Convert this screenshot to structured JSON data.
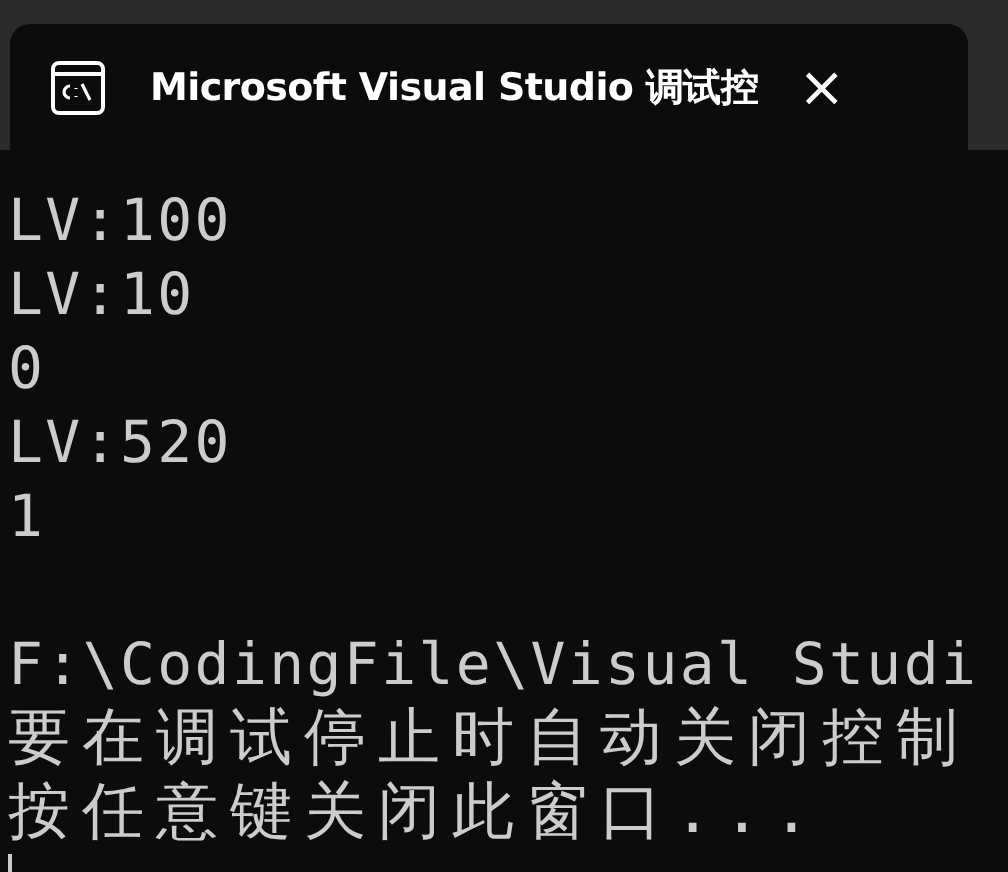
{
  "tab": {
    "title": "Microsoft Visual Studio 调试控",
    "close": "×"
  },
  "console": {
    "lines": [
      {
        "text": "LV:100"
      },
      {
        "text": "LV:10"
      },
      {
        "text": "0"
      },
      {
        "text": "LV:520"
      },
      {
        "text": "1"
      },
      {
        "kind": "blank"
      },
      {
        "text": "F:\\CodingFile\\Visual Studi"
      },
      {
        "text": "要在调试停止时自动关闭控制",
        "kind": "cjk"
      },
      {
        "text": "按任意键关闭此窗口...",
        "kind": "cjk"
      }
    ]
  }
}
